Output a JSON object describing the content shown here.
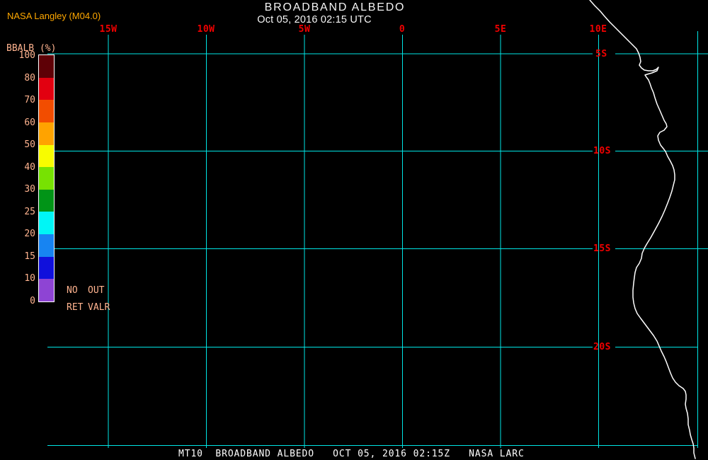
{
  "header": {
    "source_label": "NASA Langley (M04.0)",
    "title": "BROADBAND ALBEDO",
    "subtitle": "Oct 05, 2016 02:15 UTC"
  },
  "colorbar": {
    "label": "BBALB (%)",
    "units": "%",
    "ticks": [
      "100",
      "80",
      "70",
      "60",
      "50",
      "40",
      "30",
      "25",
      "20",
      "15",
      "10",
      "0"
    ],
    "segments": [
      {
        "range": "80-100",
        "color": "#5e0006"
      },
      {
        "range": "70-80",
        "color": "#e20010"
      },
      {
        "range": "60-70",
        "color": "#f24d00"
      },
      {
        "range": "50-60",
        "color": "#ffa300"
      },
      {
        "range": "40-50",
        "color": "#f8fc00"
      },
      {
        "range": "30-40",
        "color": "#77e202"
      },
      {
        "range": "25-30",
        "color": "#019417"
      },
      {
        "range": "20-25",
        "color": "#00f6f6"
      },
      {
        "range": "15-20",
        "color": "#1784f2"
      },
      {
        "range": "10-15",
        "color": "#1010dc"
      },
      {
        "range": "0-10",
        "color": "#8e44d4"
      }
    ],
    "no_retrieval_row1_left": "NO",
    "no_retrieval_row1_right": "OUT",
    "no_retrieval_row2_left": "RET",
    "no_retrieval_row2_right": "VALR"
  },
  "grid": {
    "longitude_labels": [
      "15W",
      "10W",
      "5W",
      "0",
      "5E",
      "10E"
    ],
    "latitude_labels": [
      "5S",
      "10S",
      "15S",
      "20S"
    ]
  },
  "footer": {
    "text": "MT10  BROADBAND ALBEDO   OCT 05, 2016 02:15Z   NASA LARC"
  },
  "colors": {
    "background": "#000000",
    "grid_line": "#00e6e6",
    "coastline": "#ffffff",
    "coordinate_label": "#f10000",
    "colorbar_label": "#ffb38f",
    "source_label": "#ffa800",
    "title_text": "#f5f5f5"
  }
}
